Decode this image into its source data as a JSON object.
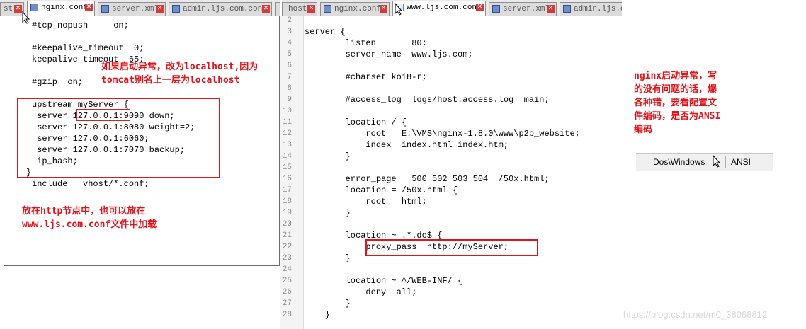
{
  "left_window": {
    "tabs": [
      {
        "label": "st"
      },
      {
        "label": "nginx.conf"
      },
      {
        "label": "server.xml"
      },
      {
        "label": "admin.ljs.com.conf"
      }
    ],
    "lines": [
      "#tcp_nopush     on;",
      "",
      "#keepalive_timeout  0;",
      "keepalive_timeout  65;",
      "",
      "#gzip  on;",
      "",
      "upstream myServer {",
      " server 127.0.0.1:9090 down;",
      " server 127.0.0.1:8080 weight=2;",
      " server 127.0.0.1:6060;",
      " server 127.0.0.1:7070 backup;",
      " ip_hash;",
      "}",
      "include   vhost/*.conf;"
    ],
    "note_top": "如果启动异常，改为localhost,因为\ntomcat别名上一层为localhost",
    "note_bottom": "放在http节点中，也可以放在\nwww.ljs.com.conf文件中加载"
  },
  "right_window": {
    "tabs": [
      {
        "label": "hosts"
      },
      {
        "label": "nginx.conf"
      },
      {
        "label": "www.ljs.com.conf"
      },
      {
        "label": "server.xml"
      },
      {
        "label": "admin.ljs.c"
      }
    ],
    "line_numbers": [
      "2",
      "3",
      "4",
      "5",
      "6",
      "7",
      "8",
      "9",
      "10",
      "11",
      "12",
      "13",
      "14",
      "15",
      "16",
      "17",
      "18",
      "19",
      "20",
      "21",
      "22",
      "23",
      "24",
      "25",
      "26",
      "27",
      "28"
    ],
    "lines": [
      "",
      "server {",
      "        listen       80;",
      "        server_name  www.ljs.com;",
      "",
      "        #charset koi8-r;",
      "",
      "        #access_log  logs/host.access.log  main;",
      "",
      "        location / {",
      "            root   E:\\VMS\\nginx-1.8.0\\www\\p2p_website;",
      "            index  index.html index.htm;",
      "        }",
      "",
      "        error_page   500 502 503 504  /50x.html;",
      "        location = /50x.html {",
      "            root   html;",
      "        }",
      "",
      "        location ~ .*.do$ {",
      "            proxy_pass  http://myServer;",
      "        }",
      "",
      "        location ~ ^/WEB-INF/ {",
      "            deny  all;",
      "        }",
      "    }"
    ]
  },
  "side_note": "nginx启动异常，写\n的没有问题的话，爆\n各种错，要看配置文\n件编码，是否为ANSI\n编码",
  "status_snippet": {
    "encoding_format": "Dos\\Windows",
    "charset": "ANSI"
  },
  "watermark": "https://blog.csdn.net/m0_38068812",
  "colors": {
    "annotation_red": "#e0141b",
    "editor_bg": "#ffffff",
    "gutter_text": "#8a8a8a"
  }
}
